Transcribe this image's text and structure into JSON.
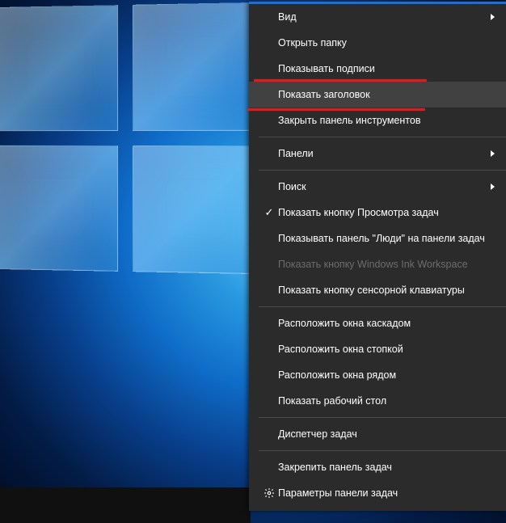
{
  "menu": {
    "items": [
      {
        "label": "Вид",
        "submenu": true
      },
      {
        "label": "Открыть папку"
      },
      {
        "label": "Показывать подписи"
      },
      {
        "label": "Показать заголовок",
        "hovered": true
      },
      {
        "label": "Закрыть панель инструментов"
      }
    ],
    "panels": {
      "label": "Панели",
      "submenu": true
    },
    "search": {
      "label": "Поиск",
      "submenu": true
    },
    "taskview": {
      "label": "Показать кнопку Просмотра задач",
      "checked": true
    },
    "people": {
      "label": "Показывать панель \"Люди\" на панели задач"
    },
    "ink": {
      "label": "Показать кнопку Windows Ink Workspace",
      "disabled": true
    },
    "touchkb": {
      "label": "Показать кнопку сенсорной клавиатуры"
    },
    "arrange": [
      {
        "label": "Расположить окна каскадом"
      },
      {
        "label": "Расположить окна стопкой"
      },
      {
        "label": "Расположить окна рядом"
      },
      {
        "label": "Показать рабочий стол"
      }
    ],
    "taskmgr": {
      "label": "Диспетчер задач"
    },
    "lock": {
      "label": "Закрепить панель задач"
    },
    "settings": {
      "label": "Параметры панели задач"
    }
  }
}
